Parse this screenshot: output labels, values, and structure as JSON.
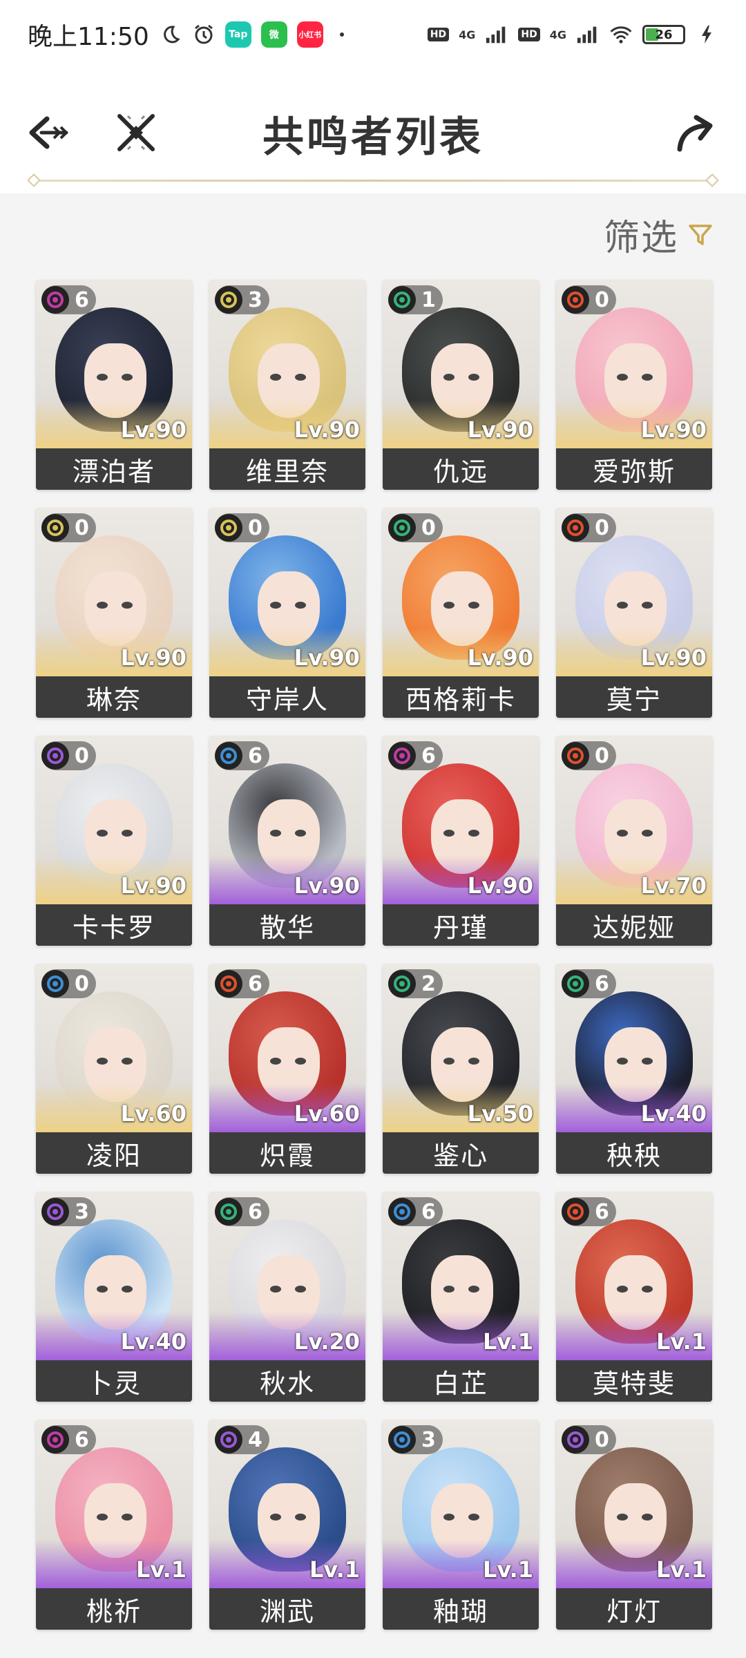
{
  "status_bar": {
    "time": "晚上11:50",
    "app_badges": [
      {
        "label": "Tap",
        "color": "#1ec8b0"
      },
      {
        "label": "微",
        "color": "#2bbf4e"
      },
      {
        "label": "小红书",
        "color": "#ff2442"
      }
    ],
    "network_1": "4G",
    "network_2": "4G",
    "hd_1": "HD",
    "hd_2": "HD",
    "battery": "26"
  },
  "header": {
    "title": "共鸣者列表"
  },
  "filter": {
    "label": "筛选"
  },
  "colors": {
    "accent_gold": "#c9a64a",
    "namebar": "#3c3c3c"
  },
  "characters": [
    {
      "name": "漂泊者",
      "level": "Lv.90",
      "chain": "6",
      "element": "aero-purple",
      "elem_color": "#c23aa6",
      "rarity": "gold",
      "hair": "#1f2433",
      "hair2": "#394055"
    },
    {
      "name": "维里奈",
      "level": "Lv.90",
      "chain": "3",
      "element": "spectro",
      "elem_color": "#d6c25a",
      "rarity": "gold",
      "hair": "#d9c27a",
      "hair2": "#eed89a"
    },
    {
      "name": "仇远",
      "level": "Lv.90",
      "chain": "1",
      "element": "aero",
      "elem_color": "#34b47a",
      "rarity": "gold",
      "hair": "#2b2d2c",
      "hair2": "#4a4f4d"
    },
    {
      "name": "爱弥斯",
      "level": "Lv.90",
      "chain": "0",
      "element": "fusion",
      "elem_color": "#e0502e",
      "rarity": "gold",
      "hair": "#f2a6b6",
      "hair2": "#f7c6cf"
    },
    {
      "name": "琳奈",
      "level": "Lv.90",
      "chain": "0",
      "element": "spectro",
      "elem_color": "#d6c25a",
      "rarity": "gold",
      "hair": "#e8d2c0",
      "hair2": "#f2e2d3"
    },
    {
      "name": "守岸人",
      "level": "Lv.90",
      "chain": "0",
      "element": "spectro",
      "elem_color": "#d6c25a",
      "rarity": "gold",
      "hair": "#3a7bd0",
      "hair2": "#7fb4ea"
    },
    {
      "name": "西格莉卡",
      "level": "Lv.90",
      "chain": "0",
      "element": "aero",
      "elem_color": "#34b47a",
      "rarity": "gold",
      "hair": "#f07a32",
      "hair2": "#f6a463"
    },
    {
      "name": "莫宁",
      "level": "Lv.90",
      "chain": "0",
      "element": "fusion",
      "elem_color": "#e0502e",
      "rarity": "gold",
      "hair": "#c8cde8",
      "hair2": "#dde0f2"
    },
    {
      "name": "卡卡罗",
      "level": "Lv.90",
      "chain": "0",
      "element": "electro",
      "elem_color": "#9a58d6",
      "rarity": "gold",
      "hair": "#d6d9de",
      "hair2": "#eceef0"
    },
    {
      "name": "散华",
      "level": "Lv.90",
      "chain": "6",
      "element": "glacio",
      "elem_color": "#3d8fd6",
      "rarity": "purple",
      "hair": "#b8bcc4",
      "hair2": "#3a3b40"
    },
    {
      "name": "丹瑾",
      "level": "Lv.90",
      "chain": "6",
      "element": "havoc",
      "elem_color": "#c23aa6",
      "rarity": "purple",
      "hair": "#d23532",
      "hair2": "#e6605a"
    },
    {
      "name": "达妮娅",
      "level": "Lv.70",
      "chain": "0",
      "element": "fusion",
      "elem_color": "#e0502e",
      "rarity": "gold",
      "hair": "#f2b5cf",
      "hair2": "#f8d2e2"
    },
    {
      "name": "凌阳",
      "level": "Lv.60",
      "chain": "0",
      "element": "glacio",
      "elem_color": "#3d8fd6",
      "rarity": "gold",
      "hair": "#dcd6cc",
      "hair2": "#ece7de"
    },
    {
      "name": "炽霞",
      "level": "Lv.60",
      "chain": "6",
      "element": "fusion",
      "elem_color": "#e0502e",
      "rarity": "purple",
      "hair": "#b8322c",
      "hair2": "#d65a4c"
    },
    {
      "name": "鉴心",
      "level": "Lv.50",
      "chain": "2",
      "element": "aero",
      "elem_color": "#34b47a",
      "rarity": "gold",
      "hair": "#23252a",
      "hair2": "#46494f"
    },
    {
      "name": "秧秧",
      "level": "Lv.40",
      "chain": "6",
      "element": "aero",
      "elem_color": "#34b47a",
      "rarity": "purple",
      "hair": "#1c1f2e",
      "hair2": "#3d6bc4"
    },
    {
      "name": "卜灵",
      "level": "Lv.40",
      "chain": "3",
      "element": "electro",
      "elem_color": "#9a58d6",
      "rarity": "purple",
      "hair": "#cfe4f4",
      "hair2": "#5d95d0"
    },
    {
      "name": "秋水",
      "level": "Lv.20",
      "chain": "6",
      "element": "aero",
      "elem_color": "#34b47a",
      "rarity": "purple",
      "hair": "#d9d9dd",
      "hair2": "#eeeef0"
    },
    {
      "name": "白芷",
      "level": "Lv.1",
      "chain": "6",
      "element": "glacio",
      "elem_color": "#3d8fd6",
      "rarity": "purple",
      "hair": "#1f2024",
      "hair2": "#3a3c40"
    },
    {
      "name": "莫特斐",
      "level": "Lv.1",
      "chain": "6",
      "element": "fusion",
      "elem_color": "#e0502e",
      "rarity": "purple",
      "hair": "#c03a2c",
      "hair2": "#de6a52"
    },
    {
      "name": "桃祈",
      "level": "Lv.1",
      "chain": "6",
      "element": "havoc",
      "elem_color": "#c23aa6",
      "rarity": "purple",
      "hair": "#ec8ea4",
      "hair2": "#f3b3c2"
    },
    {
      "name": "渊武",
      "level": "Lv.1",
      "chain": "4",
      "element": "electro",
      "elem_color": "#9a58d6",
      "rarity": "purple",
      "hair": "#2b4d8a",
      "hair2": "#4f74b8"
    },
    {
      "name": "釉瑚",
      "level": "Lv.1",
      "chain": "3",
      "element": "glacio",
      "elem_color": "#3d8fd6",
      "rarity": "purple",
      "hair": "#9cc8ee",
      "hair2": "#c9e2f7"
    },
    {
      "name": "灯灯",
      "level": "Lv.1",
      "chain": "0",
      "element": "electro",
      "elem_color": "#9a58d6",
      "rarity": "purple",
      "hair": "#7a5a4c",
      "hair2": "#a07e6c"
    }
  ]
}
